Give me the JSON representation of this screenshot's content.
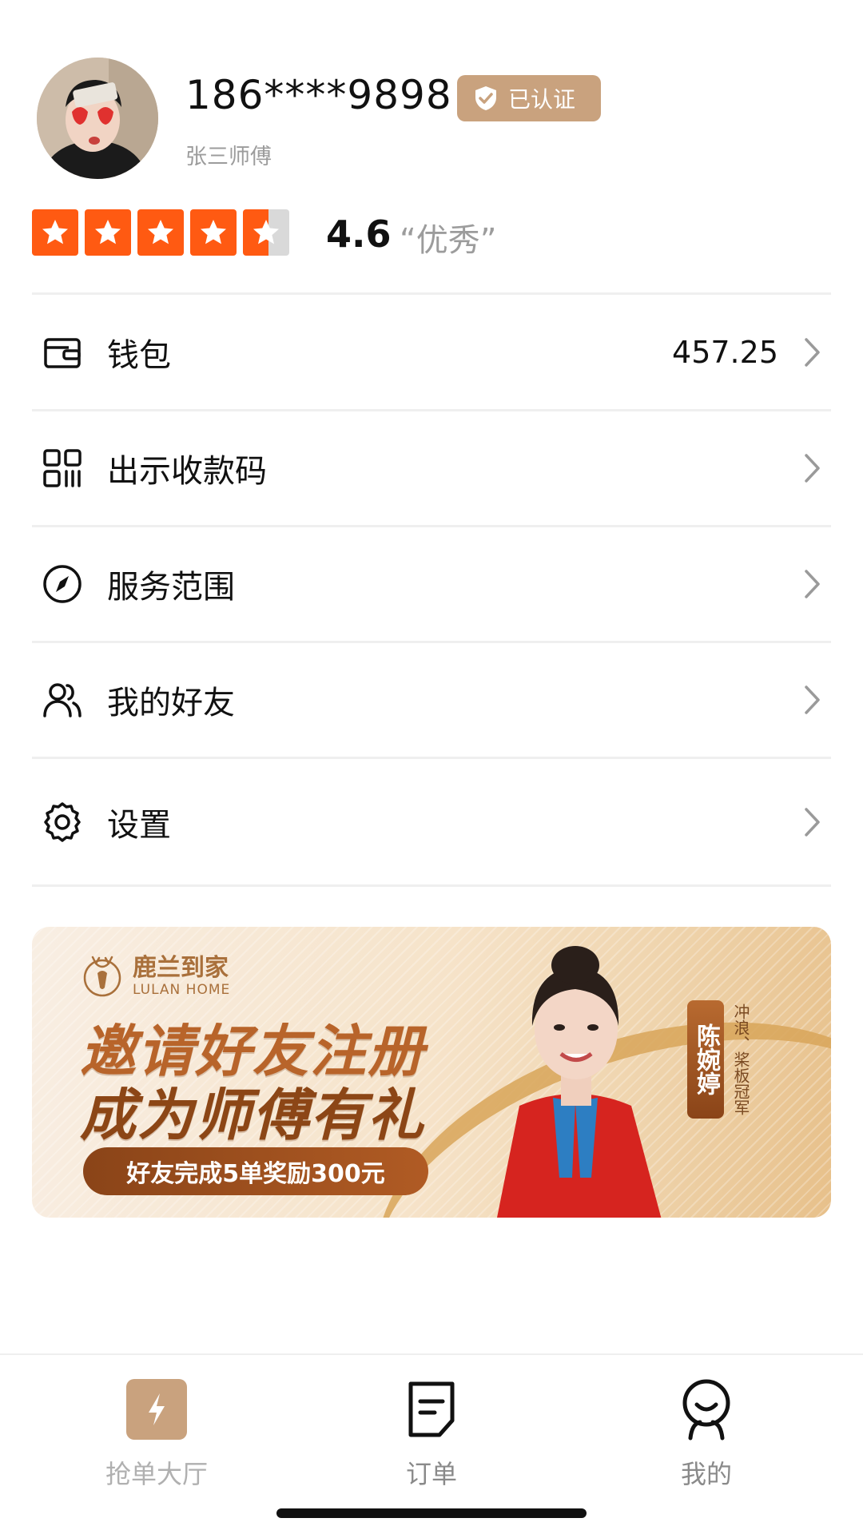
{
  "profile": {
    "phone": "186****9898",
    "verified_label": "已认证",
    "name": "张三师傅"
  },
  "rating": {
    "score": "4.6",
    "score_value": 4.6,
    "max": 5,
    "description": "“优秀”"
  },
  "menu": {
    "items": [
      {
        "label": "钱包",
        "value": "457.25",
        "icon": "wallet-icon"
      },
      {
        "label": "出示收款码",
        "value": "",
        "icon": "qr-code-icon"
      },
      {
        "label": "服务范围",
        "value": "",
        "icon": "compass-icon"
      },
      {
        "label": "我的好友",
        "value": "",
        "icon": "friends-icon"
      },
      {
        "label": "设置",
        "value": "",
        "icon": "gear-icon"
      }
    ]
  },
  "banner": {
    "brand_cn": "鹿兰到家",
    "brand_en": "LULAN HOME",
    "headline_1": "邀请好友注册",
    "headline_2": "成为师傅有礼",
    "reward": "好友完成5单奖励300元",
    "name_tag": "陈婉婷",
    "champion": "冲浪、桨板冠军"
  },
  "tabbar": {
    "tabs": [
      {
        "label": "抢单大厅",
        "icon": "lightning-icon"
      },
      {
        "label": "订单",
        "icon": "order-icon"
      },
      {
        "label": "我的",
        "icon": "profile-icon"
      }
    ]
  },
  "colors": {
    "accent": "#c9a27e",
    "star": "#ff5a12",
    "divider": "#efefef",
    "muted_text": "#9c9c9c"
  }
}
